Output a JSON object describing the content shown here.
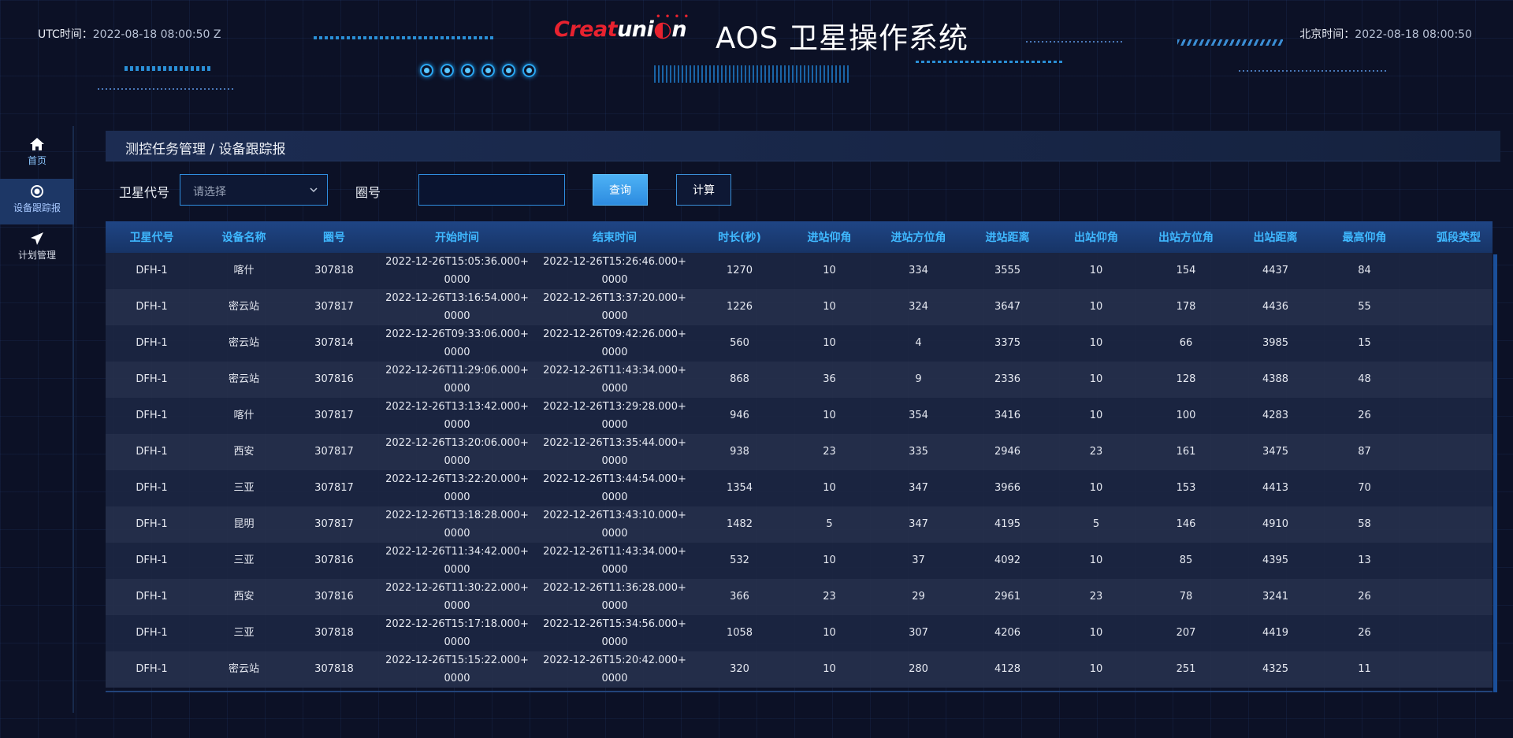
{
  "header": {
    "utc_label": "UTC时间：",
    "utc_value": "2022-08-18 08:00:50 Z",
    "logo_part1": "Creat",
    "logo_part2": "uni",
    "logo_part3": "n",
    "title": "AOS 卫星操作系统",
    "beijing_label": "北京时间：",
    "beijing_value": "2022-08-18 08:00:50"
  },
  "sidebar": {
    "items": [
      {
        "label": "首页",
        "icon": "home-icon"
      },
      {
        "label": "设备跟踪报",
        "icon": "target-icon"
      },
      {
        "label": "计划管理",
        "icon": "send-icon"
      }
    ]
  },
  "breadcrumb": "测控任务管理 / 设备跟踪报",
  "filters": {
    "satellite_label": "卫星代号",
    "satellite_placeholder": "请选择",
    "orbit_label": "圈号",
    "orbit_value": "",
    "query_button": "查询",
    "compute_button": "计算"
  },
  "table": {
    "columns": [
      "卫星代号",
      "设备名称",
      "圈号",
      "开始时间",
      "结束时间",
      "时长(秒)",
      "进站仰角",
      "进站方位角",
      "进站距离",
      "出站仰角",
      "出站方位角",
      "出站距离",
      "最高仰角",
      "弧段类型"
    ],
    "rows": [
      [
        "DFH-1",
        "喀什",
        "307818",
        "2022-12-26T15:05:36.000+0000",
        "2022-12-26T15:26:46.000+0000",
        "1270",
        "10",
        "334",
        "3555",
        "10",
        "154",
        "4437",
        "84",
        ""
      ],
      [
        "DFH-1",
        "密云站",
        "307817",
        "2022-12-26T13:16:54.000+0000",
        "2022-12-26T13:37:20.000+0000",
        "1226",
        "10",
        "324",
        "3647",
        "10",
        "178",
        "4436",
        "55",
        ""
      ],
      [
        "DFH-1",
        "密云站",
        "307814",
        "2022-12-26T09:33:06.000+0000",
        "2022-12-26T09:42:26.000+0000",
        "560",
        "10",
        "4",
        "3375",
        "10",
        "66",
        "3985",
        "15",
        ""
      ],
      [
        "DFH-1",
        "密云站",
        "307816",
        "2022-12-26T11:29:06.000+0000",
        "2022-12-26T11:43:34.000+0000",
        "868",
        "36",
        "9",
        "2336",
        "10",
        "128",
        "4388",
        "48",
        ""
      ],
      [
        "DFH-1",
        "喀什",
        "307817",
        "2022-12-26T13:13:42.000+0000",
        "2022-12-26T13:29:28.000+0000",
        "946",
        "10",
        "354",
        "3416",
        "10",
        "100",
        "4283",
        "26",
        ""
      ],
      [
        "DFH-1",
        "西安",
        "307817",
        "2022-12-26T13:20:06.000+0000",
        "2022-12-26T13:35:44.000+0000",
        "938",
        "23",
        "335",
        "2946",
        "23",
        "161",
        "3475",
        "87",
        ""
      ],
      [
        "DFH-1",
        "三亚",
        "307817",
        "2022-12-26T13:22:20.000+0000",
        "2022-12-26T13:44:54.000+0000",
        "1354",
        "10",
        "347",
        "3966",
        "10",
        "153",
        "4413",
        "70",
        ""
      ],
      [
        "DFH-1",
        "昆明",
        "307817",
        "2022-12-26T13:18:28.000+0000",
        "2022-12-26T13:43:10.000+0000",
        "1482",
        "5",
        "347",
        "4195",
        "5",
        "146",
        "4910",
        "58",
        ""
      ],
      [
        "DFH-1",
        "三亚",
        "307816",
        "2022-12-26T11:34:42.000+0000",
        "2022-12-26T11:43:34.000+0000",
        "532",
        "10",
        "37",
        "4092",
        "10",
        "85",
        "4395",
        "13",
        ""
      ],
      [
        "DFH-1",
        "西安",
        "307816",
        "2022-12-26T11:30:22.000+0000",
        "2022-12-26T11:36:28.000+0000",
        "366",
        "23",
        "29",
        "2961",
        "23",
        "78",
        "3241",
        "26",
        ""
      ],
      [
        "DFH-1",
        "三亚",
        "307818",
        "2022-12-26T15:17:18.000+0000",
        "2022-12-26T15:34:56.000+0000",
        "1058",
        "10",
        "307",
        "4206",
        "10",
        "207",
        "4419",
        "26",
        ""
      ],
      [
        "DFH-1",
        "密云站",
        "307818",
        "2022-12-26T15:15:22.000+0000",
        "2022-12-26T15:20:42.000+0000",
        "320",
        "10",
        "280",
        "4128",
        "10",
        "251",
        "4325",
        "11",
        ""
      ]
    ]
  },
  "colors": {
    "accent": "#3fb8ff",
    "background": "#0c1126",
    "header_row": "#1f4585",
    "logo_red": "#e8222f"
  }
}
